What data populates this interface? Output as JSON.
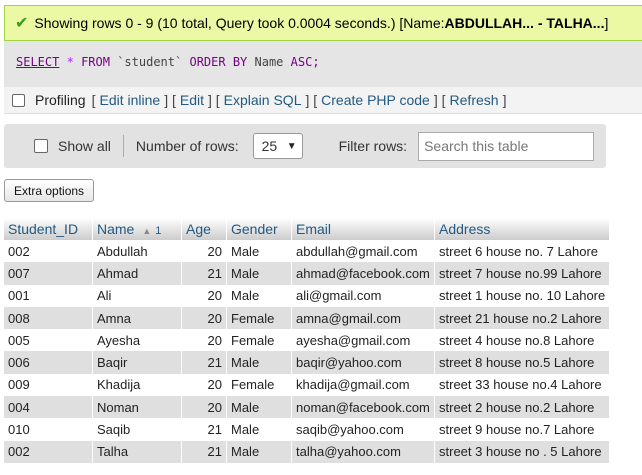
{
  "success": {
    "text": "Showing rows 0 - 9 (10 total, Query took 0.0004 seconds.) [Name: ",
    "range": "ABDULLAH... - TALHA...",
    "close": "]"
  },
  "sql": {
    "select": "SELECT",
    "star": "*",
    "from": "FROM",
    "table": "`student`",
    "orderby": "ORDER BY",
    "col": "Name",
    "asc": "ASC;"
  },
  "profiling": {
    "label": "Profiling",
    "links": [
      "Edit inline",
      "Edit",
      "Explain SQL",
      "Create PHP code",
      "Refresh"
    ]
  },
  "nav": {
    "show_all": "Show all",
    "rows_label": "Number of rows:",
    "rows_value": "25",
    "filter_label": "Filter rows:",
    "search_placeholder": "Search this table"
  },
  "extra_options": "Extra options",
  "table": {
    "headers": [
      "Student_ID",
      "Name",
      "Age",
      "Gender",
      "Email",
      "Address"
    ],
    "sort_num": "1",
    "rows": [
      [
        "002",
        "Abdullah",
        "20",
        "Male",
        "abdullah@gmail.com",
        "street 6 house no. 7 Lahore"
      ],
      [
        "007",
        "Ahmad",
        "21",
        "Male",
        "ahmad@facebook.com",
        "street 7 house no.99 Lahore"
      ],
      [
        "001",
        "Ali",
        "20",
        "Male",
        "ali@gmail.com",
        "street 1 house no. 10 Lahore"
      ],
      [
        "008",
        "Amna",
        "20",
        "Female",
        "amna@gmail.com",
        "street 21 house no.2 Lahore"
      ],
      [
        "005",
        "Ayesha",
        "20",
        "Female",
        "ayesha@gmail.com",
        "street 4 house no.8 Lahore"
      ],
      [
        "006",
        "Baqir",
        "21",
        "Male",
        "baqir@yahoo.com",
        "street 8 house no.5 Lahore"
      ],
      [
        "009",
        "Khadija",
        "20",
        "Female",
        "khadija@gmail.com",
        "street 33 house no.4 Lahore"
      ],
      [
        "004",
        "Noman",
        "20",
        "Male",
        "noman@facebook.com",
        "street 2 house no.2 Lahore"
      ],
      [
        "010",
        "Saqib",
        "21",
        "Male",
        "saqib@yahoo.com",
        "street 9 house no.7 Lahore"
      ],
      [
        "002",
        "Talha",
        "21",
        "Male",
        "talha@yahoo.com",
        "street 3 house no . 5 Lahore"
      ]
    ]
  }
}
